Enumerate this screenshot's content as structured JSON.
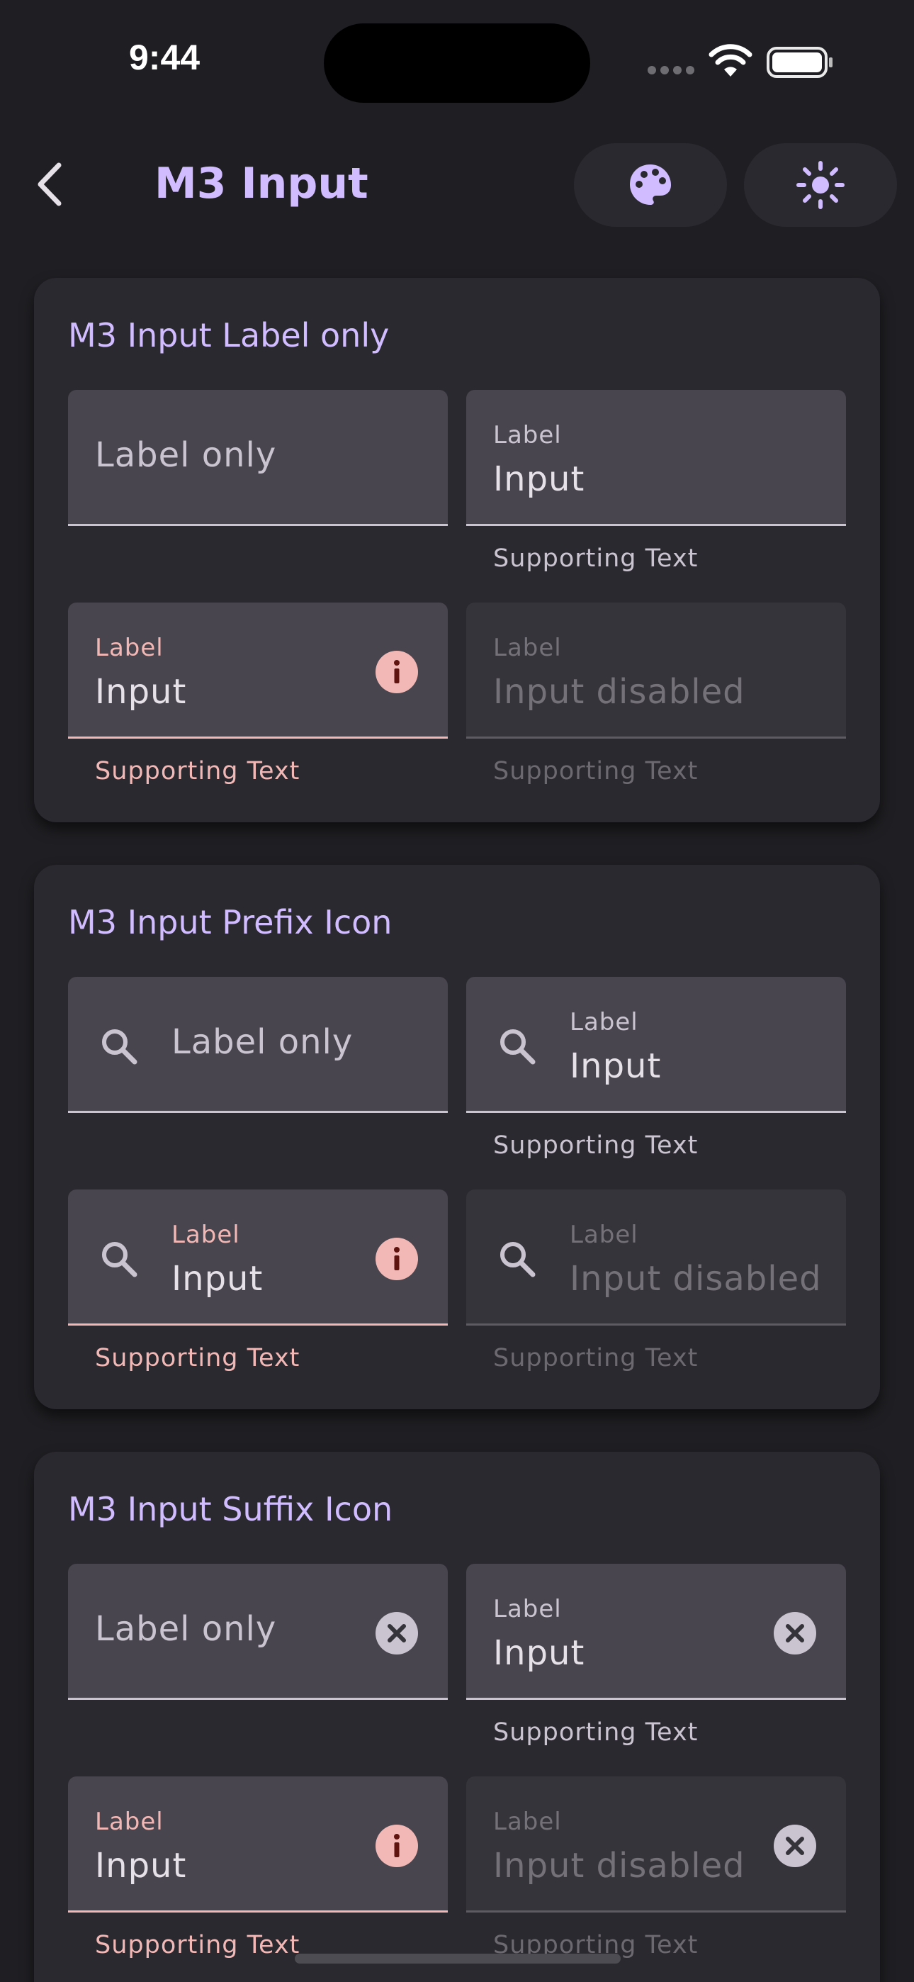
{
  "status_bar": {
    "time": "9:44"
  },
  "app_bar": {
    "title": "M3 Input"
  },
  "colors": {
    "primary": "#d0bcff",
    "error": "#f2b8b5",
    "surface": "#2b2930",
    "field_fill": "#49454f",
    "background": "#1f1e22"
  },
  "cards": [
    {
      "title": "M3 Input Label only",
      "fields": [
        {
          "state": "default",
          "label_only": "Label only"
        },
        {
          "state": "default",
          "label": "Label",
          "value": "Input",
          "supporting": "Supporting Text"
        },
        {
          "state": "error",
          "label": "Label",
          "value": "Input",
          "supporting": "Supporting Text",
          "suffix_icon": "info-icon"
        },
        {
          "state": "disabled",
          "label": "Label",
          "value": "Input disabled",
          "supporting": "Supporting Text"
        }
      ]
    },
    {
      "title": "M3 Input Prefix Icon",
      "fields": [
        {
          "state": "default",
          "label_only": "Label only",
          "prefix_icon": "search-icon"
        },
        {
          "state": "default",
          "label": "Label",
          "value": "Input",
          "supporting": "Supporting Text",
          "prefix_icon": "search-icon"
        },
        {
          "state": "error",
          "label": "Label",
          "value": "Input",
          "supporting": "Supporting Text",
          "prefix_icon": "search-icon",
          "suffix_icon": "info-icon"
        },
        {
          "state": "disabled",
          "label": "Label",
          "value": "Input disabled",
          "supporting": "Supporting Text",
          "prefix_icon": "search-icon"
        }
      ]
    },
    {
      "title": "M3 Input Suffix Icon",
      "fields": [
        {
          "state": "default",
          "label_only": "Label only",
          "suffix_icon": "clear-icon"
        },
        {
          "state": "default",
          "label": "Label",
          "value": "Input",
          "supporting": "Supporting Text",
          "suffix_icon": "clear-icon"
        },
        {
          "state": "error",
          "label": "Label",
          "value": "Input",
          "supporting": "Supporting Text",
          "suffix_icon": "info-icon"
        },
        {
          "state": "disabled",
          "label": "Label",
          "value": "Input disabled",
          "supporting": "Supporting Text",
          "suffix_icon": "clear-icon"
        }
      ]
    }
  ]
}
